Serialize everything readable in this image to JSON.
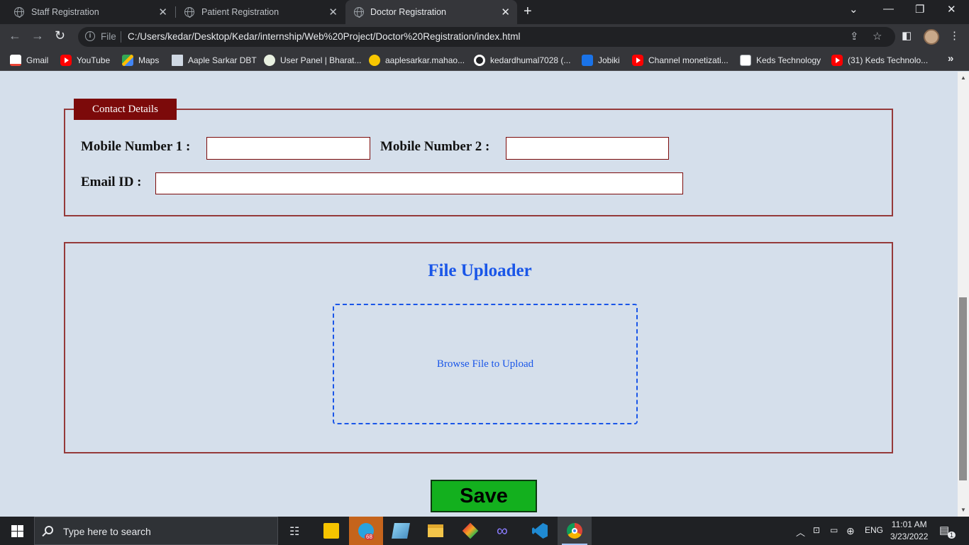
{
  "browser": {
    "tabs": [
      {
        "title": "Staff Registration",
        "active": false
      },
      {
        "title": "Patient Registration",
        "active": false
      },
      {
        "title": "Doctor Registration",
        "active": true
      }
    ],
    "address": {
      "scheme_label": "File",
      "url": "C:/Users/kedar/Desktop/Kedar/internship/Web%20Project/Doctor%20Registration/index.html"
    },
    "bookmarks": [
      {
        "label": "Gmail",
        "icon": "gmail-icon"
      },
      {
        "label": "YouTube",
        "icon": "youtube-icon"
      },
      {
        "label": "Maps",
        "icon": "maps-icon"
      },
      {
        "label": "Aaple Sarkar DBT",
        "icon": "document-icon"
      },
      {
        "label": "User Panel | Bharat...",
        "icon": "user-panel-icon"
      },
      {
        "label": "aaplesarkar.mahao...",
        "icon": "sun-icon"
      },
      {
        "label": "kedardhumal7028 (...",
        "icon": "github-icon"
      },
      {
        "label": "Jobiki",
        "icon": "jobiki-icon"
      },
      {
        "label": "Channel monetizati...",
        "icon": "youtube-icon"
      },
      {
        "label": "Keds Technology",
        "icon": "keds-icon"
      },
      {
        "label": "(31) Keds Technolo...",
        "icon": "youtube-icon"
      }
    ]
  },
  "form": {
    "contact": {
      "legend": "Contact Details",
      "mobile1_label": "Mobile Number 1 :",
      "mobile1_value": "",
      "mobile2_label": "Mobile Number 2 :",
      "mobile2_value": "",
      "email_label": "Email ID :",
      "email_value": ""
    },
    "uploader": {
      "title": "File Uploader",
      "browse_text": "Browse File to Upload"
    },
    "save_label": "Save"
  },
  "taskbar": {
    "search_placeholder": "Type here to search",
    "telegram_badge": "68",
    "language": "ENG",
    "time": "11:01 AM",
    "date": "3/23/2022",
    "notification_count": "1"
  },
  "colors": {
    "page_bg": "#d5dfeb",
    "accent_maroon": "#7c0a0a",
    "uploader_blue": "#1a56e8",
    "save_green": "#13b01e"
  }
}
